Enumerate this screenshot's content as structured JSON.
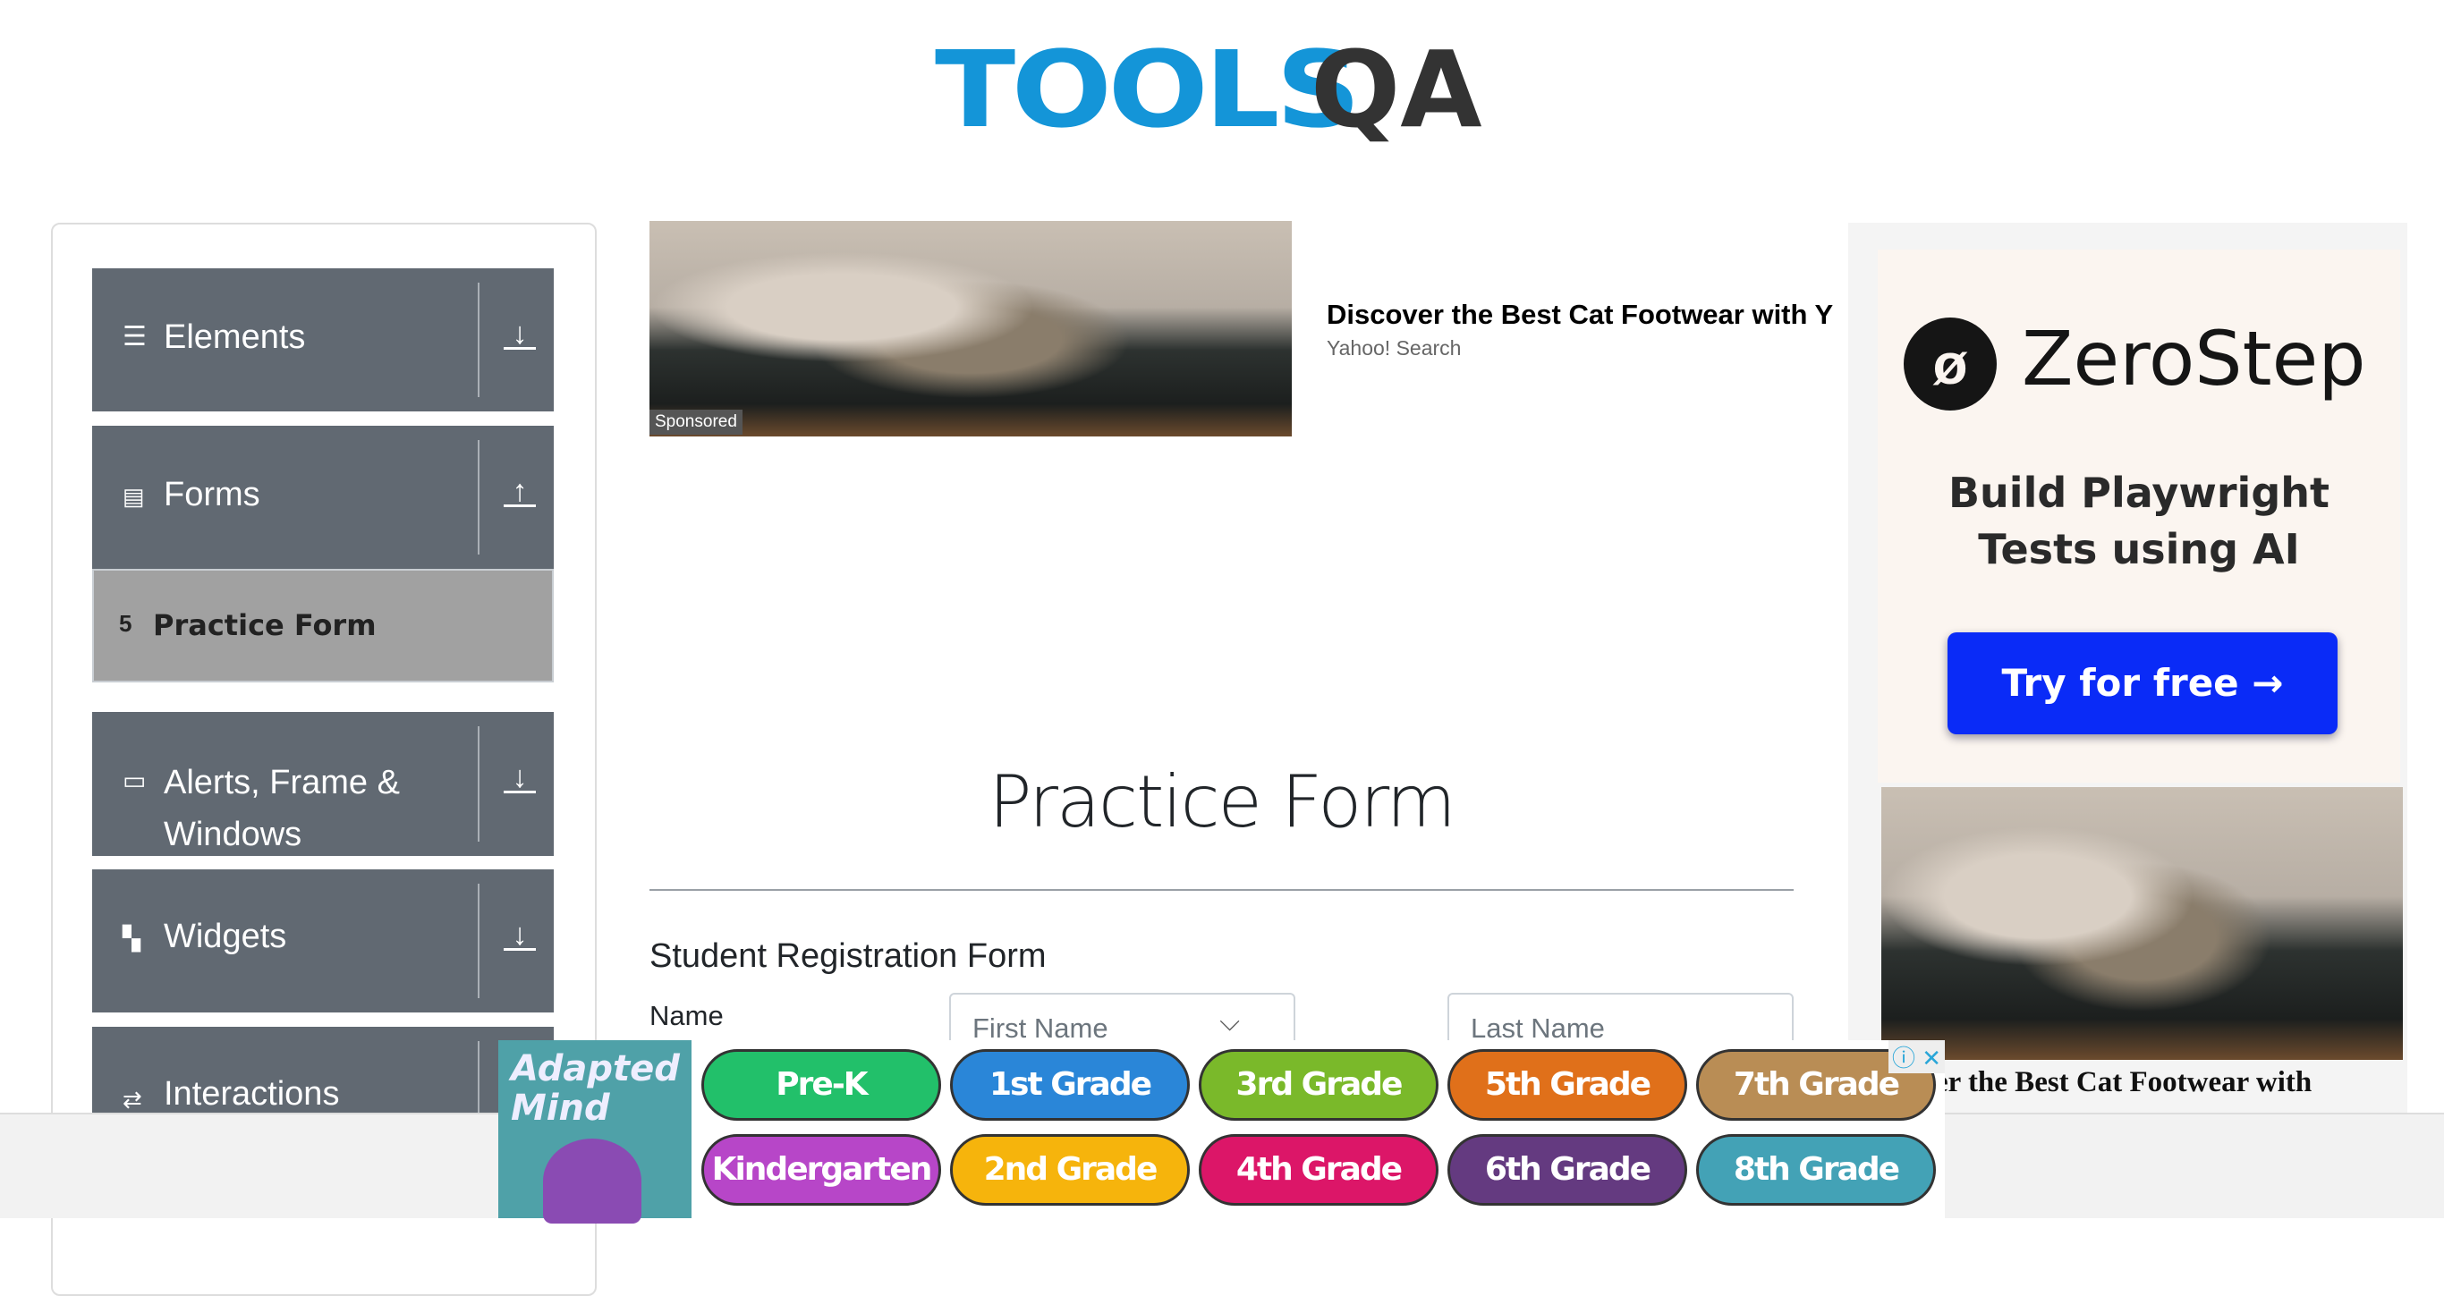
{
  "logo": {
    "text_blue": "TOOLS",
    "text_dark": "QA"
  },
  "sidebar": {
    "groups": [
      {
        "label": "Elements",
        "icon": "hamburger-icon",
        "toggle": "download-arrow-icon"
      },
      {
        "label": "Forms",
        "icon": "form-icon",
        "toggle": "upload-arrow-icon",
        "expanded": true,
        "items": [
          {
            "label": "Practice Form",
            "icon": "html5-icon",
            "active": true
          }
        ]
      },
      {
        "label": "Alerts, Frame & Windows",
        "icon": "window-icon",
        "toggle": "download-arrow-icon"
      },
      {
        "label": "Widgets",
        "icon": "widgets-icon",
        "toggle": "download-arrow-icon"
      },
      {
        "label": "Interactions",
        "icon": "interactions-icon",
        "toggle": "download-arrow-icon"
      }
    ]
  },
  "top_ad": {
    "title": "Discover the Best Cat Footwear with Y",
    "source": "Yahoo! Search",
    "badge": "Sponsored"
  },
  "main": {
    "title": "Practice Form",
    "subtitle": "Student Registration Form",
    "name_label": "Name",
    "first_name_placeholder": "First Name",
    "last_name_placeholder": "Last Name"
  },
  "right_ad": {
    "brand": "ZeroStep",
    "tagline_1": "Build Playwright",
    "tagline_2": "Tests using AI",
    "cta": "Try for free →",
    "caption": "over the Best Cat Footwear with"
  },
  "bottom_ad": {
    "brand_1": "Adapted",
    "brand_2": "Mind",
    "grades": [
      {
        "label": "Pre-K",
        "color": "#22c06a"
      },
      {
        "label": "1st Grade",
        "color": "#2a86d8"
      },
      {
        "label": "3rd Grade",
        "color": "#7ab92a"
      },
      {
        "label": "5th Grade",
        "color": "#e0701a"
      },
      {
        "label": "7th Grade",
        "color": "#b98d55"
      },
      {
        "label": "Kindergarten",
        "color": "#b746c8"
      },
      {
        "label": "2nd Grade",
        "color": "#f6b40c"
      },
      {
        "label": "4th Grade",
        "color": "#dc1668"
      },
      {
        "label": "6th Grade",
        "color": "#643a80"
      },
      {
        "label": "8th Grade",
        "color": "#43a2b6"
      }
    ],
    "close": "ⓘ ✕"
  }
}
